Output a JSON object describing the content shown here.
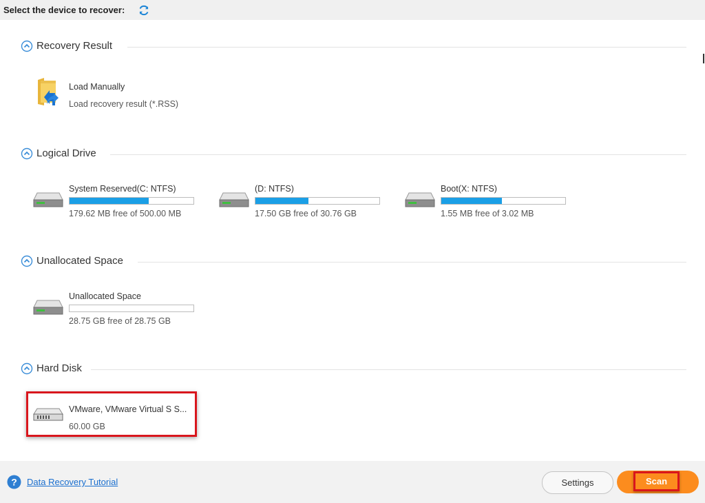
{
  "header": {
    "title": "Select the device to recover:",
    "refresh_icon": "refresh-icon"
  },
  "sections": {
    "recovery_result": {
      "label": "Recovery Result",
      "load_manually": {
        "title": "Load Manually",
        "subtitle": "Load recovery result (*.RSS)",
        "icon": "folder-arrow-icon"
      }
    },
    "logical_drive": {
      "label": "Logical Drive",
      "drives": [
        {
          "name": "System Reserved(C: NTFS)",
          "info": "179.62 MB free of 500.00 MB",
          "used_fraction": 0.64
        },
        {
          "name": "(D: NTFS)",
          "info": "17.50 GB free of 30.76 GB",
          "used_fraction": 0.43
        },
        {
          "name": "Boot(X: NTFS)",
          "info": "1.55 MB free of 3.02 MB",
          "used_fraction": 0.49
        }
      ]
    },
    "unallocated": {
      "label": "Unallocated Space",
      "item": {
        "name": "Unallocated Space",
        "info": "28.75 GB free of 28.75 GB",
        "used_fraction": 0.0
      }
    },
    "hard_disk": {
      "label": "Hard Disk",
      "item": {
        "name": "VMware, VMware Virtual S S...",
        "info": "60.00 GB"
      }
    }
  },
  "footer": {
    "tutorial_link": "Data Recovery Tutorial",
    "settings_label": "Settings",
    "scan_label": "Scan"
  },
  "colors": {
    "accent": "#1b9fe6",
    "scan_button": "#fc8c1e",
    "highlight": "#d9161d",
    "link": "#1a6fcf"
  }
}
